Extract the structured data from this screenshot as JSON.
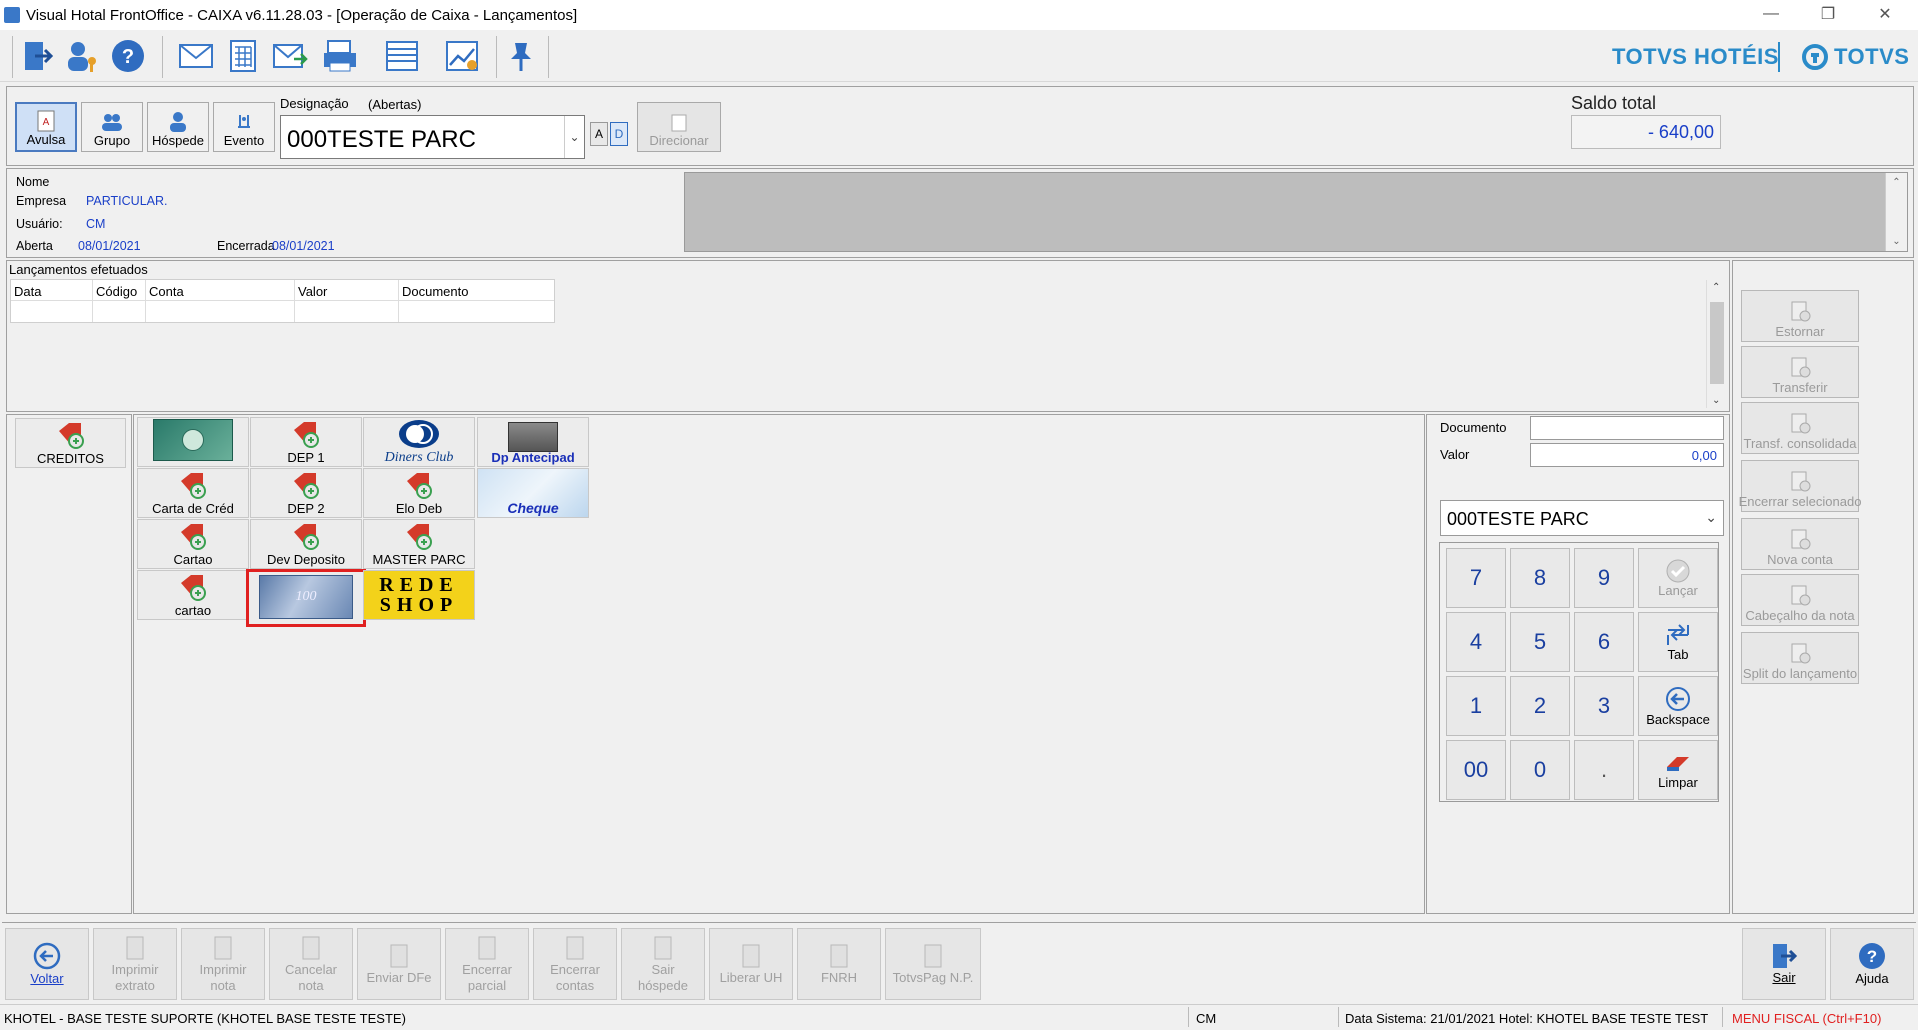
{
  "window": {
    "title": "Visual Hotal FrontOffice - CAIXA v6.11.28.03 - [Operação de Caixa - Lançamentos]"
  },
  "brand": {
    "left": "TOTVS HOTÉIS",
    "right": "TOTVS"
  },
  "type_buttons": [
    {
      "label": "Avulsa"
    },
    {
      "label": "Grupo"
    },
    {
      "label": "Hóspede"
    },
    {
      "label": "Evento"
    }
  ],
  "designacao": {
    "label": "Designação",
    "sub": "(Abertas)",
    "value": "000TESTE PARC",
    "btn_a": "A",
    "btn_d": "D",
    "direcionar": "Direcionar"
  },
  "saldo": {
    "label": "Saldo total",
    "value": "- 640,00"
  },
  "info": {
    "nome_label": "Nome",
    "empresa_label": "Empresa",
    "empresa_value": "PARTICULAR.",
    "usuario_label": "Usuário:",
    "usuario_value": "CM",
    "aberta_label": "Aberta",
    "aberta_value": "08/01/2021",
    "encerrada_label": "Encerrada",
    "encerrada_value": "08/01/2021"
  },
  "lancamentos": {
    "title": "Lançamentos efetuados",
    "columns": [
      "Data",
      "Código",
      "Conta",
      "Valor",
      "Documento"
    ]
  },
  "creditos": {
    "label": "CREDITOS"
  },
  "tiles": [
    {
      "label": "",
      "kind": "amex"
    },
    {
      "label": "DEP 1",
      "kind": "tag"
    },
    {
      "label": "Diners Club",
      "kind": "diners"
    },
    {
      "label": "Dp Antecipad",
      "kind": "img"
    },
    {
      "label": "Carta de Créd",
      "kind": "tag"
    },
    {
      "label": "DEP 2",
      "kind": "tag"
    },
    {
      "label": "Elo Deb",
      "kind": "tag"
    },
    {
      "label": "Cheque",
      "kind": "cheque"
    },
    {
      "label": "Cartao",
      "kind": "tag"
    },
    {
      "label": "Dev Deposito",
      "kind": "tag"
    },
    {
      "label": "MASTER PARC",
      "kind": "tag"
    },
    {
      "label": "cartao",
      "kind": "tag"
    },
    {
      "label": "",
      "kind": "money"
    },
    {
      "label": "REDE SHOP",
      "kind": "redeshop"
    }
  ],
  "redeshop": {
    "line1": "REDE",
    "line2": "SHOP"
  },
  "form": {
    "documento_label": "Documento",
    "documento_value": "",
    "valor_label": "Valor",
    "valor_value": "0,00",
    "account_select": "000TESTE PARC"
  },
  "keypad": {
    "digits": [
      "7",
      "8",
      "9",
      "4",
      "5",
      "6",
      "1",
      "2",
      "3",
      "00",
      "0",
      "."
    ],
    "lancar": "Lançar",
    "tab": "Tab",
    "backspace": "Backspace",
    "limpar": "Limpar"
  },
  "side_buttons": [
    "Estornar",
    "Transferir",
    "Transf. consolidada",
    "Encerrar selecionado",
    "Nova conta",
    "Cabeçalho da nota",
    "Split do lançamento"
  ],
  "bottom_buttons": [
    {
      "l1": "Voltar",
      "l2": ""
    },
    {
      "l1": "Imprimir",
      "l2": "extrato"
    },
    {
      "l1": "Imprimir",
      "l2": "nota"
    },
    {
      "l1": "Cancelar",
      "l2": "nota"
    },
    {
      "l1": "Enviar DFe",
      "l2": ""
    },
    {
      "l1": "Encerrar",
      "l2": "parcial"
    },
    {
      "l1": "Encerrar",
      "l2": "contas"
    },
    {
      "l1": "Sair",
      "l2": "hóspede"
    },
    {
      "l1": "Liberar UH",
      "l2": ""
    },
    {
      "l1": "FNRH",
      "l2": ""
    },
    {
      "l1": "TotvsPag N.P.",
      "l2": ""
    }
  ],
  "right_buttons": {
    "sair": "Sair",
    "ajuda": "Ajuda"
  },
  "status": {
    "left": "KHOTEL - BASE TESTE SUPORTE (KHOTEL  BASE TESTE TESTE)",
    "user": "CM",
    "data": "Data Sistema: 21/01/2021  Hotel:  KHOTEL  BASE TESTE TEST",
    "menu": "MENU FISCAL (Ctrl+F10)"
  },
  "colors": {
    "accent": "#2a8bc9",
    "link": "#1a3fc8",
    "highlight": "#e02020",
    "fiscal": "#e02020"
  }
}
